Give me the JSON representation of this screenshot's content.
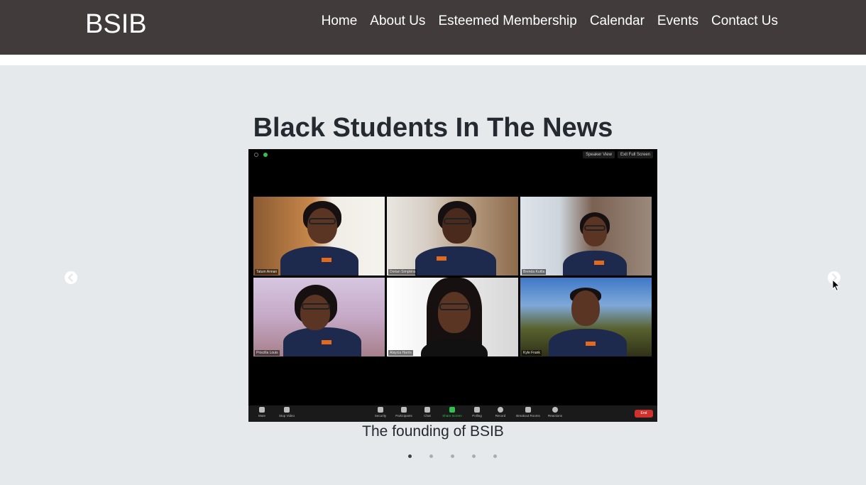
{
  "navbar": {
    "brand": "BSIB",
    "links": [
      "Home",
      "About Us",
      "Esteemed Membership",
      "Calendar",
      "Events",
      "Contact Us"
    ],
    "background_color": "#413b3b"
  },
  "news_section": {
    "title": "Black Students In The News",
    "background_color": "#e6e9ec",
    "carousel": {
      "active_index": 0,
      "slide_count": 5,
      "caption": "The founding of BSIB",
      "prev_icon": "chevron-left-icon",
      "next_icon": "chevron-right-icon",
      "slide": {
        "view_buttons": [
          "Speaker View",
          "Exit Full Screen"
        ],
        "participants": [
          "Tatum Annan",
          "Dorian Simpkins",
          "Brenda Kuttla",
          "Priscilla Louis",
          "Alaycia Harris",
          "Kyle Frank"
        ],
        "toolbar": [
          "Mute",
          "Stop Video",
          "Security",
          "Participants",
          "Chat",
          "Share Screen",
          "Polling",
          "Record",
          "Breakout Rooms",
          "Reactions"
        ],
        "end_label": "End"
      }
    }
  }
}
